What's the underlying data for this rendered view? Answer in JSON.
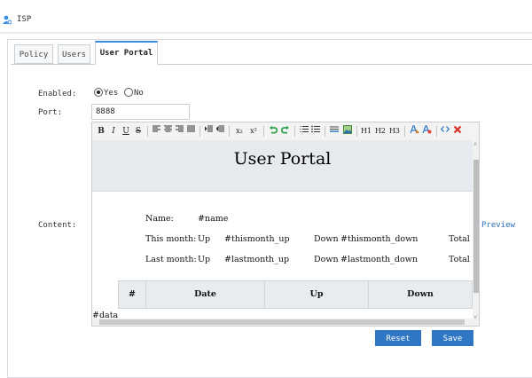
{
  "window": {
    "title": "ISP"
  },
  "tabs": [
    {
      "label": "Policy"
    },
    {
      "label": "Users"
    },
    {
      "label": "User Portal"
    }
  ],
  "form": {
    "enabled_label": "Enabled:",
    "yes_label": "Yes",
    "no_label": "No",
    "enabled_value": "Yes",
    "port_label": "Port:",
    "port_value": "8888",
    "content_label": "Content:",
    "preview_label": "Preview"
  },
  "toolbar": {
    "bold": "B",
    "italic": "I",
    "underline": "U",
    "strike": "S",
    "subscript": "x₂",
    "superscript": "x²",
    "h1": "H1",
    "h2": "H2",
    "h3": "H3"
  },
  "document": {
    "title": "User Portal",
    "name_label": "Name:",
    "name_value": "#name",
    "this_month_label": "This month:",
    "this_month_up": "Up",
    "this_month_up_value": "#thismonth_up",
    "this_month_down": "Down",
    "this_month_down_value": "#thismonth_down",
    "this_month_total": "Total",
    "last_month_label": "Last month:",
    "last_month_up": "Up",
    "last_month_up_value": "#lastmonth_up",
    "last_month_down": "Down",
    "last_month_down_value": "#lastmonth_down",
    "last_month_total": "Total",
    "table_headers": [
      "#",
      "Date",
      "Up",
      "Down"
    ],
    "data_placeholder": "#data"
  },
  "buttons": {
    "reset": "Reset",
    "save": "Save"
  },
  "colors": {
    "accent": "#2f76c4",
    "tab_active_border": "#3a8ee6",
    "link": "#2c6fbd",
    "undo_green": "#2ea44f",
    "delete_red": "#d93025"
  }
}
